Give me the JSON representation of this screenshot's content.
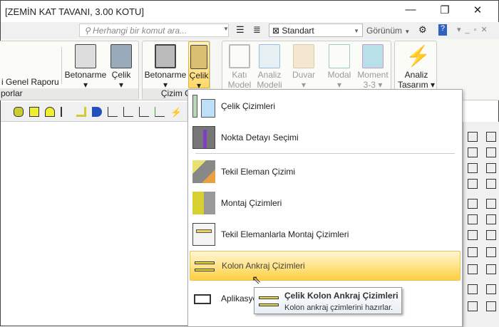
{
  "window": {
    "title": "[ZEMİN KAT TAVANI,  3.00 KOTU]"
  },
  "quickbar": {
    "search_placeholder": "Herhangi bir komut ara...",
    "style_value": "Standart",
    "view_label": "Görünüm"
  },
  "ribbon": {
    "groups": [
      {
        "label": "porlar",
        "buttons": [
          "i Genel Raporu",
          "Betonarme",
          "Çelik"
        ]
      },
      {
        "label": "Çizim Ol",
        "buttons": [
          "Betonarme",
          "Çelik"
        ]
      },
      {
        "label": "",
        "buttons": [
          "Katı Model",
          "Analiz Modeli",
          "Duvar",
          "Modal",
          "Moment 3-3"
        ]
      },
      {
        "label": "",
        "buttons": [
          "Analiz Tasarım"
        ]
      }
    ]
  },
  "menu": {
    "items": [
      {
        "label": "Çelik Çizimleri"
      },
      {
        "label": "Nokta Detayı Seçimi"
      },
      {
        "label": "Tekil Eleman Çizimi"
      },
      {
        "label": "Montaj Çizimleri"
      },
      {
        "label": "Tekil Elemanlarla Montaj Çizimleri"
      },
      {
        "label": "Kolon Ankraj Çizimleri",
        "highlighted": true
      },
      {
        "label": "Aplikasyo"
      }
    ]
  },
  "tooltip": {
    "title": "Çelik Kolon Ankraj Çizimleri",
    "description": "Kolon ankraj çzimlerini hazırlar."
  }
}
